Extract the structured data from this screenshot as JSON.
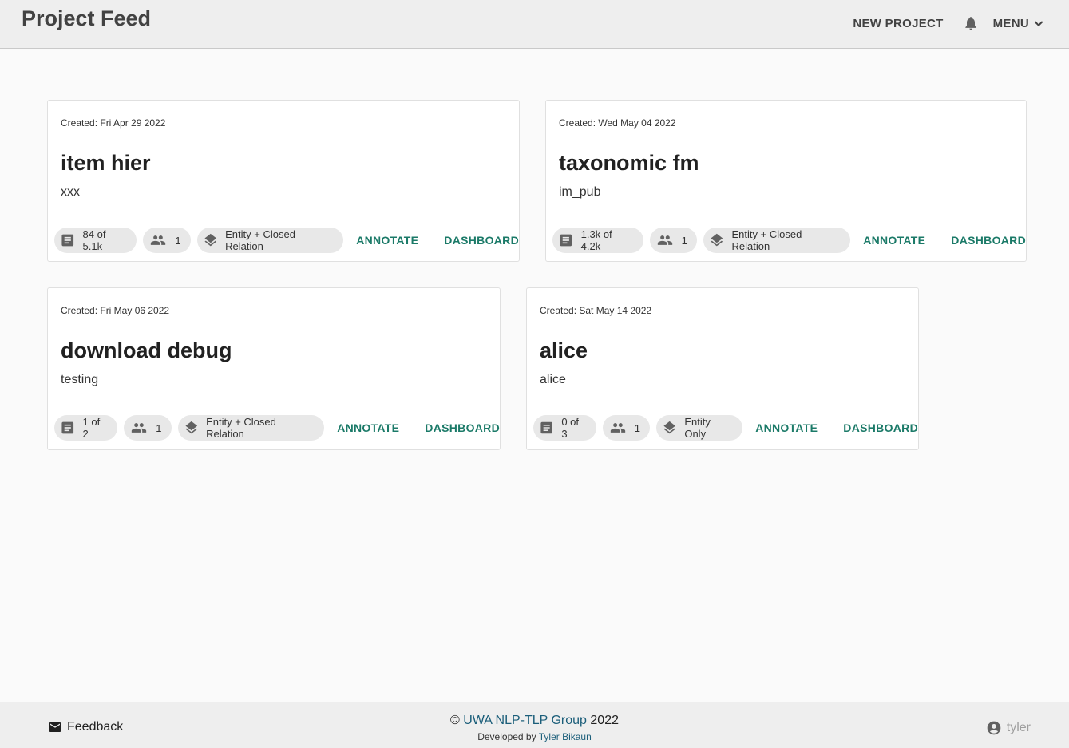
{
  "header": {
    "title": "Project Feed",
    "new_project": "NEW PROJECT",
    "menu": "MENU"
  },
  "projects": [
    {
      "created": "Created: Fri Apr 29 2022",
      "name": "item hier",
      "description": "xxx",
      "docs": "84 of 5.1k",
      "annotators": "1",
      "type": "Entity + Closed Relation",
      "annotate": "ANNOTATE",
      "dashboard": "DASHBOARD"
    },
    {
      "created": "Created: Wed May 04 2022",
      "name": "taxonomic fm",
      "description": "im_pub",
      "docs": "1.3k of 4.2k",
      "annotators": "1",
      "type": "Entity + Closed Relation",
      "annotate": "ANNOTATE",
      "dashboard": "DASHBOARD"
    },
    {
      "created": "Created: Fri May 06 2022",
      "name": "download debug",
      "description": "testing",
      "docs": "1 of 2",
      "annotators": "1",
      "type": "Entity + Closed Relation",
      "annotate": "ANNOTATE",
      "dashboard": "DASHBOARD"
    },
    {
      "created": "Created: Sat May 14 2022",
      "name": "alice",
      "description": "alice",
      "docs": "0 of 3",
      "annotators": "1",
      "type": "Entity Only",
      "annotate": "ANNOTATE",
      "dashboard": "DASHBOARD"
    }
  ],
  "footer": {
    "feedback": "Feedback",
    "copyright_prefix": "©",
    "group": "UWA NLP-TLP Group",
    "year": "2022",
    "developed_by": "Developed by",
    "developer": "Tyler Bikaun",
    "username": "tyler"
  },
  "icons": {
    "bell": "bell-icon",
    "menu_chevron": "chevron-down-icon",
    "docs": "article-icon",
    "annotators": "people-icon",
    "type": "layers-icon",
    "feedback": "mail-icon",
    "user": "account-circle-icon"
  },
  "colors": {
    "accent": "#1b7a68",
    "link": "#1b5e7a",
    "appbar": "#eeeeee"
  }
}
